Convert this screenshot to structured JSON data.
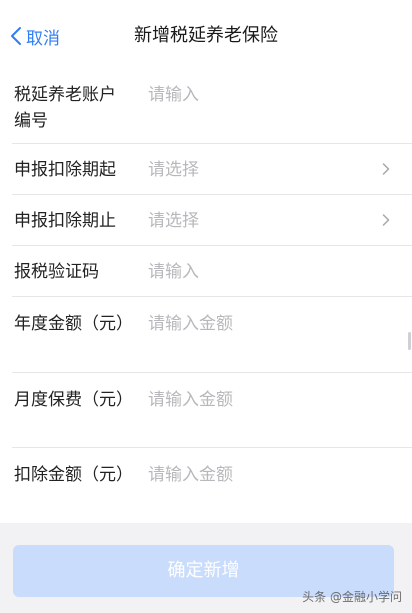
{
  "navbar": {
    "back_label": "取消",
    "title": "新增税延养老保险"
  },
  "form": {
    "fields": [
      {
        "label": "税延养老账户编号",
        "placeholder": "请输入",
        "has_chevron": false
      },
      {
        "label": "申报扣除期起",
        "placeholder": "请选择",
        "has_chevron": true
      },
      {
        "label": "申报扣除期止",
        "placeholder": "请选择",
        "has_chevron": true
      },
      {
        "label": "报税验证码",
        "placeholder": "请输入",
        "has_chevron": false
      },
      {
        "label": "年度金额（元）",
        "placeholder": "请输入金额",
        "has_chevron": false
      },
      {
        "label": "月度保费（元）",
        "placeholder": "请输入金额",
        "has_chevron": false
      },
      {
        "label": "扣除金额（元）",
        "placeholder": "请输入金额",
        "has_chevron": false
      }
    ]
  },
  "footer": {
    "confirm_label": "确定新增",
    "watermark": "头条 @金融小学问"
  },
  "colors": {
    "accent": "#2f7ef5",
    "button_disabled": "#c9dcfb",
    "placeholder": "#b8b8bc"
  }
}
